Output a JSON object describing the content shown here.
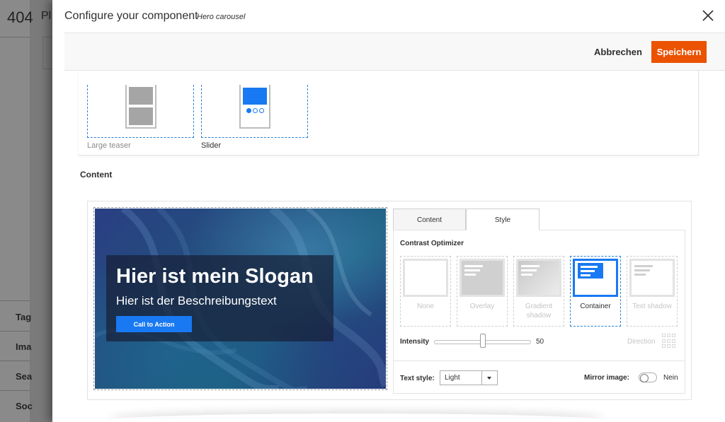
{
  "background": {
    "page_number": "404",
    "title_fragment": "Pl",
    "side_items": [
      "Tag",
      "Ima",
      "Sea",
      "Soc"
    ]
  },
  "modal": {
    "title": "Configure your component",
    "subtitle": "Hero carousel"
  },
  "actions": {
    "cancel_label": "Abbrechen",
    "save_label": "Speichern"
  },
  "layouts": {
    "items": [
      {
        "label": "Large teaser",
        "selected": false
      },
      {
        "label": "Slider",
        "selected": true
      }
    ]
  },
  "content": {
    "heading": "Content"
  },
  "preview": {
    "slogan": "Hier ist mein Slogan",
    "description": "Hier ist der Beschreibungstext",
    "cta_label": "Call to Action"
  },
  "tabs": [
    {
      "label": "Content",
      "active": false
    },
    {
      "label": "Style",
      "active": true
    }
  ],
  "contrast": {
    "label": "Contrast Optimizer",
    "options": [
      {
        "label": "None",
        "selected": false
      },
      {
        "label": "Overlay",
        "selected": false
      },
      {
        "label": "Gradient shadow",
        "selected": false
      },
      {
        "label": "Container",
        "selected": true
      },
      {
        "label": "Text shadow",
        "selected": false
      }
    ],
    "intensity_label": "Intensity",
    "intensity_value": 50,
    "direction_label": "Direction"
  },
  "text_style": {
    "label": "Text style:",
    "value": "Light"
  },
  "mirror_image": {
    "label": "Mirror image:",
    "value": "Nein",
    "enabled": false
  },
  "colors": {
    "accent": "#1979f2",
    "primary_button": "#eb5202"
  }
}
